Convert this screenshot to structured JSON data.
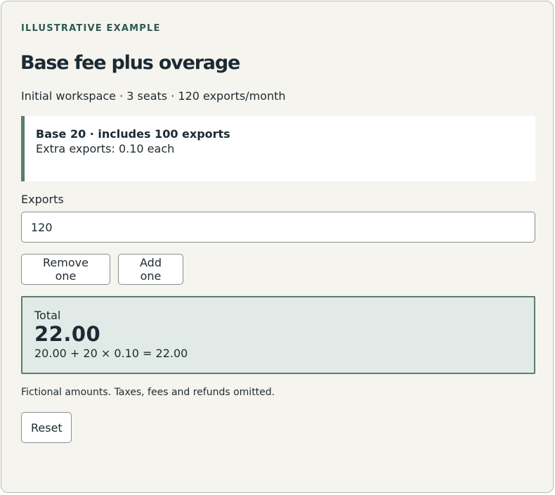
{
  "header": {
    "eyebrow": "ILLUSTRATIVE EXAMPLE",
    "title": "Base fee plus overage",
    "subtitle": "Initial workspace · 3 seats · 120 exports/month"
  },
  "plan": {
    "headline": "Base 20 · includes 100 exports",
    "extra": "Extra exports: 0.10 each"
  },
  "exports_field": {
    "label": "Exports",
    "value": "120"
  },
  "buttons": {
    "remove_label": "Remove one",
    "add_label": "Add one",
    "reset_label": "Reset"
  },
  "total": {
    "label": "Total",
    "value": "22.00",
    "formula": "20.00 + 20 × 0.10 = 22.00"
  },
  "note": "Fictional amounts. Taxes, fees and refunds omitted.",
  "colors": {
    "background": "#f5f4ef",
    "accent": "#5a7d72",
    "eyebrow": "#2e5a4f",
    "total_background": "#e1eae6",
    "text": "#1f2a30"
  }
}
